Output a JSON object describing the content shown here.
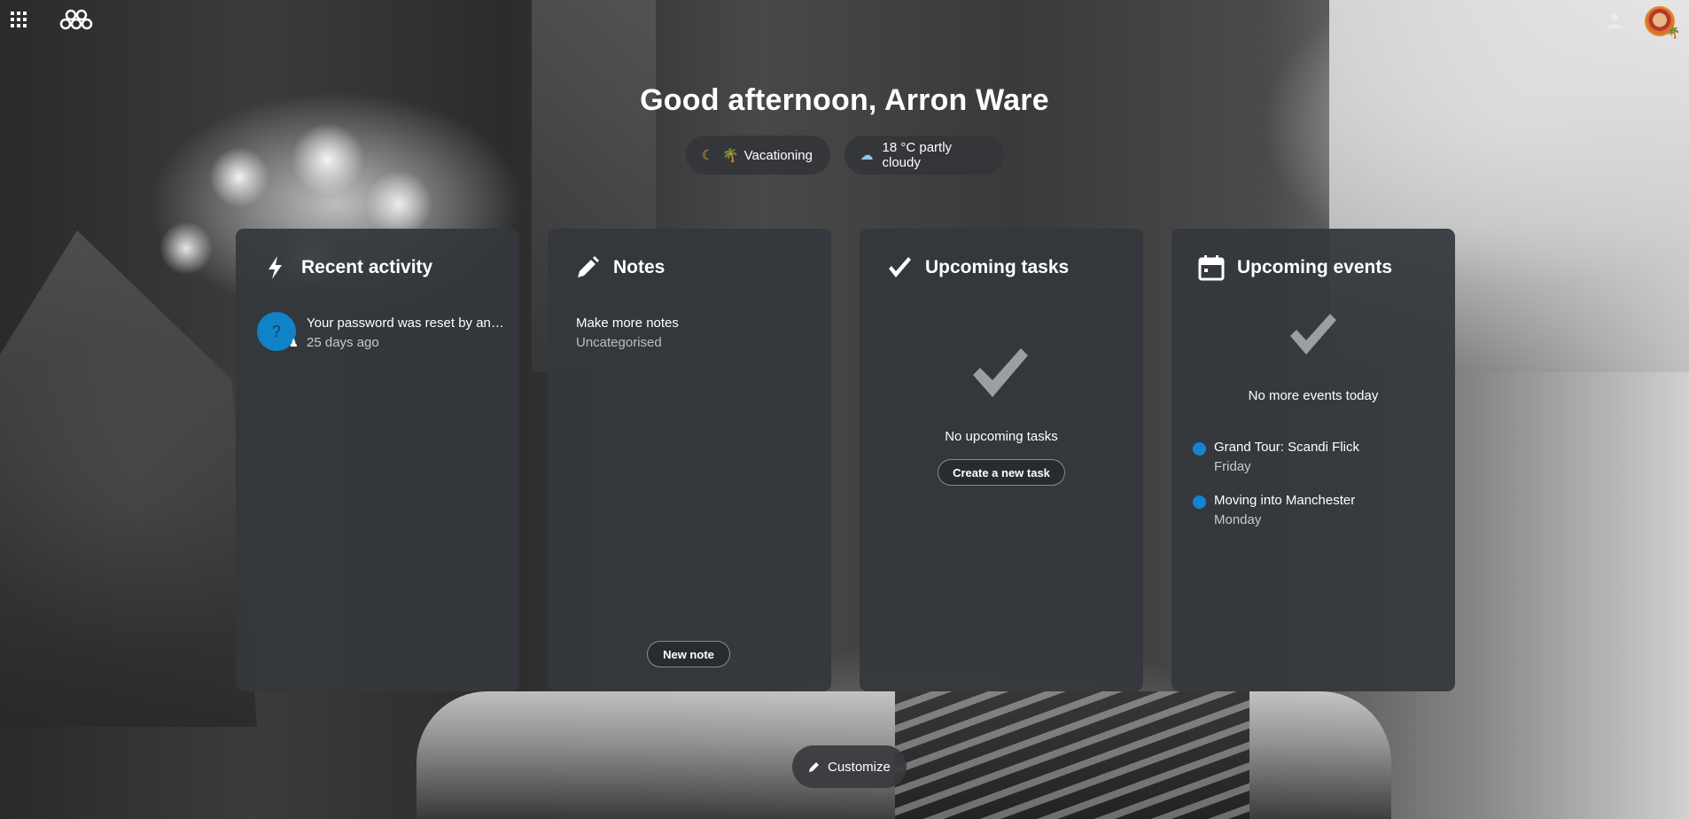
{
  "header": {
    "apps_icon": "apps-grid-icon",
    "logo_icon": "nextcloud-logo-icon",
    "status_icon": "user-status-icon",
    "avatar_icon": "user-avatar",
    "avatar_badge": "🌴"
  },
  "greeting": "Good afternoon, Arron Ware",
  "status_pills": {
    "status": {
      "icon": "moon-icon",
      "emoji": "🌴",
      "label": "Vacationing"
    },
    "weather": {
      "icon": "partly-cloudy-icon",
      "label": "18 °C partly cloudy"
    }
  },
  "panels": {
    "activity": {
      "title": "Recent activity",
      "icon": "lightning-icon",
      "items": [
        {
          "avatar_text": "?",
          "text": "Your password was reset by an ...",
          "time": "25 days ago"
        }
      ]
    },
    "notes": {
      "title": "Notes",
      "icon": "pencil-icon",
      "items": [
        {
          "title": "Make more notes",
          "category": "Uncategorised"
        }
      ],
      "button": "New note"
    },
    "tasks": {
      "title": "Upcoming tasks",
      "icon": "checkmark-icon",
      "empty_text": "No upcoming tasks",
      "button": "Create a new task"
    },
    "events": {
      "title": "Upcoming events",
      "icon": "calendar-icon",
      "empty_text": "No more events today",
      "items": [
        {
          "title": "Grand Tour: Scandi Flick",
          "day": "Friday",
          "color": "#1583d0"
        },
        {
          "title": "Moving into Manchester",
          "day": "Monday",
          "color": "#1583d0"
        }
      ]
    }
  },
  "customize": {
    "icon": "pencil-icon",
    "label": "Customize"
  },
  "colors": {
    "panel_bg": "#34373c",
    "accent_blue": "#0f82c8",
    "text": "#ffffff",
    "muted_text": "#c9c9c9"
  }
}
